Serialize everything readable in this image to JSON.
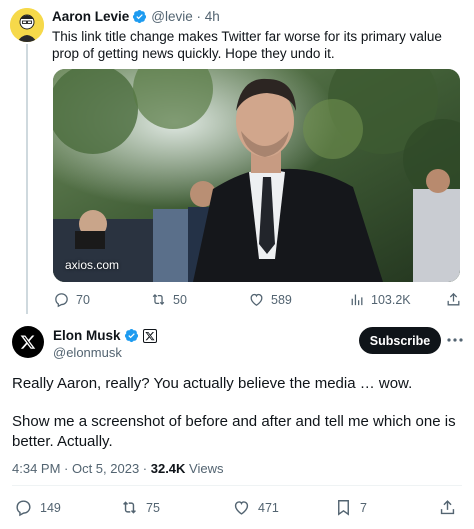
{
  "parent_tweet": {
    "author_name": "Aaron Levie",
    "author_handle": "@levie",
    "time": "4h",
    "separator": "·",
    "text": "This link title change makes Twitter far worse for its primary value prop of getting news quickly. Hope they undo it.",
    "media_source": "axios.com",
    "stats": {
      "replies": "70",
      "retweets": "50",
      "likes": "589",
      "views": "103.2K"
    }
  },
  "main_tweet": {
    "author_name": "Elon Musk",
    "author_handle": "@elonmusk",
    "subscribe_label": "Subscribe",
    "paragraph_1": "Really Aaron, really? You actually believe the media … wow.",
    "paragraph_2": "Show me a screenshot of before and after and tell me which one is better. Actually.",
    "timestamp": "4:34 PM · Oct 5, 2023 · ",
    "views_count": "32.4K",
    "views_label": " Views",
    "stats": {
      "replies": "149",
      "retweets": "75",
      "likes": "471",
      "bookmarks": "7"
    }
  },
  "colors": {
    "verified_blue": "#1d9bf0",
    "text_primary": "#0f1419",
    "text_muted": "#536471",
    "avatar_yellow": "#f6d94a"
  },
  "icons": [
    "reply-icon",
    "retweet-icon",
    "like-icon",
    "views-icon",
    "share-icon",
    "bookmark-icon",
    "verified-badge-icon",
    "x-logo-icon",
    "more-icon"
  ]
}
